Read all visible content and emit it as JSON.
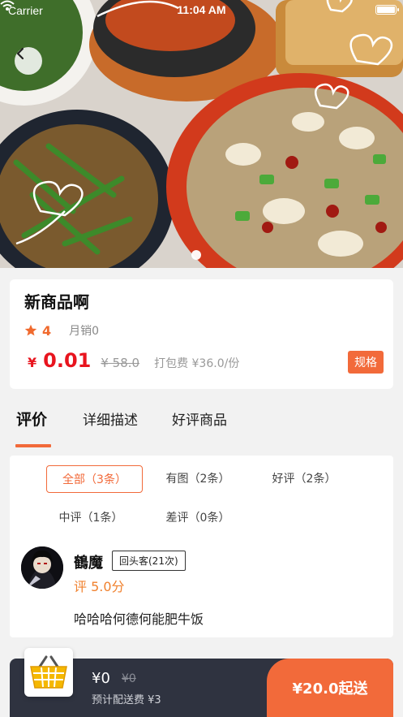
{
  "status_bar": {
    "carrier": "Carrier",
    "time": "11:04 AM"
  },
  "product": {
    "title": "新商品啊",
    "rating": "4",
    "monthly_sales": "月销0",
    "price_symbol": "¥",
    "price": "0.01",
    "original_price": "¥ 58.0",
    "packing_fee": "打包费 ¥36.0/份",
    "spec_label": "规格"
  },
  "tabs": [
    {
      "label": "评价",
      "active": true
    },
    {
      "label": "详细描述",
      "active": false
    },
    {
      "label": "好评商品",
      "active": false
    }
  ],
  "review_filters": [
    {
      "label": "全部（3条）",
      "active": true
    },
    {
      "label": "有图（2条）",
      "active": false
    },
    {
      "label": "好评（2条）",
      "active": false
    },
    {
      "label": "中评（1条）",
      "active": false
    },
    {
      "label": "差评（0条）",
      "active": false
    }
  ],
  "review": {
    "name": "鶴魔",
    "badge": "回头客(21次)",
    "score": "评 5.0分",
    "text": "哈哈哈何德何能肥牛饭"
  },
  "cart": {
    "total": "¥0",
    "original_total": "¥0",
    "delivery_fee": "预计配送费 ¥3",
    "checkout_label": "¥20.0起送"
  },
  "colors": {
    "accent": "#f26a3a",
    "price_red": "#e8141e",
    "bar_dark": "#2f3340"
  }
}
